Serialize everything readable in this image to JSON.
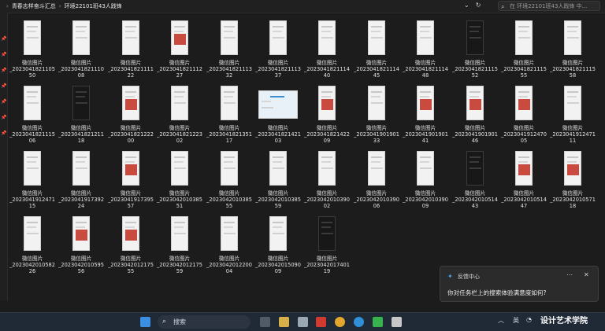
{
  "address_bar": {
    "crumbs": [
      "青春志样奋斗汇总",
      "环境22101班43人践锋"
    ],
    "search_placeholder": "在 环境22101班43人践锋 中..."
  },
  "files": [
    {
      "l1": "微信图片",
      "l2": "_2023041821105",
      "l3": "50",
      "thumb": "light"
    },
    {
      "l1": "微信图片",
      "l2": "_2023041821110",
      "l3": "08",
      "thumb": "light"
    },
    {
      "l1": "微信图片",
      "l2": "_2023041821111",
      "l3": "22",
      "thumb": "light"
    },
    {
      "l1": "微信图片",
      "l2": "_2023041821112",
      "l3": "27",
      "thumb": "card"
    },
    {
      "l1": "微信图片",
      "l2": "_2023041821113",
      "l3": "32",
      "thumb": "light"
    },
    {
      "l1": "微信图片",
      "l2": "_2023041821113",
      "l3": "37",
      "thumb": "light"
    },
    {
      "l1": "微信图片",
      "l2": "_2023041821114",
      "l3": "40",
      "thumb": "light"
    },
    {
      "l1": "微信图片",
      "l2": "_2023041821114",
      "l3": "45",
      "thumb": "light"
    },
    {
      "l1": "微信图片",
      "l2": "_2023041821114",
      "l3": "48",
      "thumb": "light"
    },
    {
      "l1": "微信图片",
      "l2": "_2023041821115",
      "l3": "52",
      "thumb": "dark"
    },
    {
      "l1": "微信图片",
      "l2": "_2023041821115",
      "l3": "55",
      "thumb": "light"
    },
    {
      "l1": "微信图片",
      "l2": "_2023041821115",
      "l3": "58",
      "thumb": "light"
    },
    {
      "l1": "微信图片",
      "l2": "_2023041821115",
      "l3": "06",
      "thumb": "light"
    },
    {
      "l1": "微信图片",
      "l2": "_2023041821211",
      "l3": "18",
      "thumb": "dark"
    },
    {
      "l1": "微信图片",
      "l2": "_2023041821222",
      "l3": "00",
      "thumb": "card"
    },
    {
      "l1": "微信图片",
      "l2": "_2023041821223",
      "l3": "02",
      "thumb": "light"
    },
    {
      "l1": "微信图片",
      "l2": "_2023041821351",
      "l3": "17",
      "thumb": "light"
    },
    {
      "l1": "微信图片",
      "l2": "_2023041821421",
      "l3": "03",
      "thumb": "wide"
    },
    {
      "l1": "微信图片",
      "l2": "_2023041821422",
      "l3": "09",
      "thumb": "card"
    },
    {
      "l1": "微信图片",
      "l2": "_2023041901901",
      "l3": "33",
      "thumb": "light"
    },
    {
      "l1": "微信图片",
      "l2": "_2023041901901",
      "l3": "41",
      "thumb": "card"
    },
    {
      "l1": "微信图片",
      "l2": "_2023041901901",
      "l3": "46",
      "thumb": "card"
    },
    {
      "l1": "微信图片",
      "l2": "_2023041912470",
      "l3": "05",
      "thumb": "card"
    },
    {
      "l1": "微信图片",
      "l2": "_2023041912471",
      "l3": "11",
      "thumb": "light"
    },
    {
      "l1": "微信图片",
      "l2": "_2023041912471",
      "l3": "15",
      "thumb": "light"
    },
    {
      "l1": "微信图片",
      "l2": "_2023041917392",
      "l3": "24",
      "thumb": "light"
    },
    {
      "l1": "微信图片",
      "l2": "_2023041917395",
      "l3": "57",
      "thumb": "card"
    },
    {
      "l1": "微信图片",
      "l2": "_2023042010385",
      "l3": "51",
      "thumb": "light"
    },
    {
      "l1": "微信图片",
      "l2": "_2023042010385",
      "l3": "55",
      "thumb": "light"
    },
    {
      "l1": "微信图片",
      "l2": "_2023042010385",
      "l3": "59",
      "thumb": "light"
    },
    {
      "l1": "微信图片",
      "l2": "_2023042010390",
      "l3": "02",
      "thumb": "light"
    },
    {
      "l1": "微信图片",
      "l2": "_2023042010390",
      "l3": "06",
      "thumb": "light"
    },
    {
      "l1": "微信图片",
      "l2": "_2023042010390",
      "l3": "09",
      "thumb": "light"
    },
    {
      "l1": "微信图片",
      "l2": "_2023042010514",
      "l3": "43",
      "thumb": "dark"
    },
    {
      "l1": "微信图片",
      "l2": "_2023042010514",
      "l3": "47",
      "thumb": "card"
    },
    {
      "l1": "微信图片",
      "l2": "_2023042010571",
      "l3": "18",
      "thumb": "card"
    },
    {
      "l1": "微信图片",
      "l2": "_2023042010582",
      "l3": "26",
      "thumb": "light"
    },
    {
      "l1": "微信图片",
      "l2": "_2023042010595",
      "l3": "56",
      "thumb": "card"
    },
    {
      "l1": "微信图片",
      "l2": "_2023042012175",
      "l3": "55",
      "thumb": "card"
    },
    {
      "l1": "微信图片",
      "l2": "_2023042012175",
      "l3": "59",
      "thumb": "light"
    },
    {
      "l1": "微信图片",
      "l2": "_2023042012200",
      "l3": "04",
      "thumb": "light"
    },
    {
      "l1": "微信图片",
      "l2": "_2023042015090",
      "l3": "09",
      "thumb": "light"
    },
    {
      "l1": "微信图片",
      "l2": "_2023042017401",
      "l3": "19",
      "thumb": "dark"
    }
  ],
  "toast": {
    "app": "反馈中心",
    "message": "你对任务栏上的搜索体验满意度如何?"
  },
  "taskbar": {
    "search_label": "搜索",
    "lang": "英"
  },
  "watermark": "设计艺术学院"
}
